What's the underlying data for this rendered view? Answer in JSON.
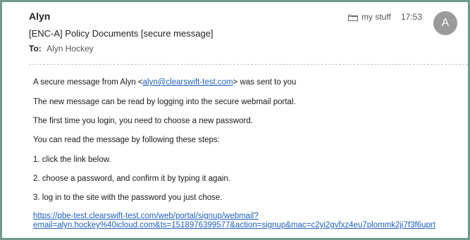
{
  "header": {
    "sender": "Alyn",
    "subject": "[ENC-A] Policy Documents [secure message]",
    "to_label": "To:",
    "to_value": "Alyn Hockey",
    "folder": "my stuff",
    "time": "17:53",
    "avatar_initial": "A"
  },
  "message": {
    "intro_prefix": "A secure message from Alyn <",
    "intro_email": "alyn@clearswift-test.com",
    "intro_suffix": "> was sent to you",
    "line_2": "The new message can be read by logging into the secure webmail portal.",
    "line_3": "The first time you login, you need to choose a new password.",
    "line_4": "You can read the message by following these steps:",
    "step_1": "1. click the link below.",
    "step_2": "2. choose a password, and confirm it by typing it again.",
    "step_3": "3. log in to the site with the password you just chose.",
    "url_line_1": "https://pbe-test.clearswift-test.com/web/portal/signup/webmail?",
    "url_line_2": "email=alyn.hockey%40icloud.com&ts=1518976399577&action=signup&mac=c2yi2gvfxz4eu7plommk2ji7f3f6uprt"
  },
  "colors": {
    "frame_border": "#6f9a8c",
    "link": "#1f5fb8",
    "avatar": "#9a9a9a"
  }
}
